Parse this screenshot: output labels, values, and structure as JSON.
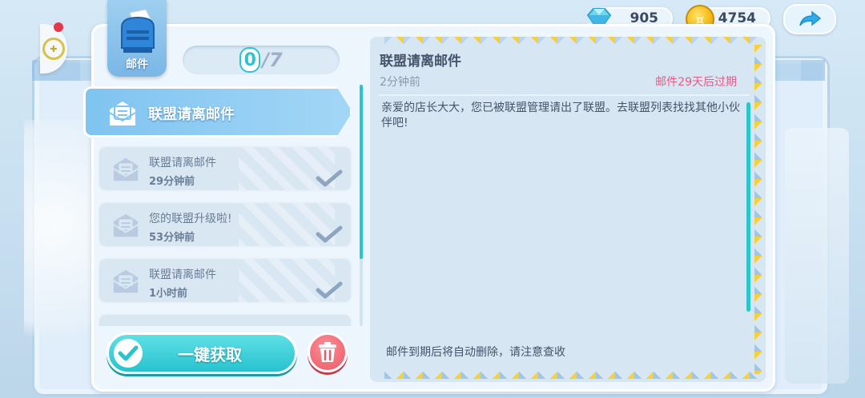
{
  "header": {
    "gems": "905",
    "coins": "4754"
  },
  "mailbox": {
    "label": "邮件"
  },
  "counter": {
    "read": "0",
    "total": "/7"
  },
  "mail_list": [
    {
      "title": "联盟请离邮件",
      "time": "",
      "selected": true,
      "read": false
    },
    {
      "title": "联盟请离邮件",
      "time": "29分钟前",
      "selected": false,
      "read": true
    },
    {
      "title": "您的联盟升级啦!",
      "time": "53分钟前",
      "selected": false,
      "read": true
    },
    {
      "title": "联盟请离邮件",
      "time": "1小时前",
      "selected": false,
      "read": true
    }
  ],
  "detail": {
    "title": "联盟请离邮件",
    "time": "2分钟前",
    "expire": "邮件29天后过期",
    "body": "亲爱的店长大大，您已被联盟管理请出了联盟。去联盟列表找找其他小伙伴吧!",
    "footer": "邮件到期后将自动删除，请注意查收"
  },
  "buttons": {
    "collect_all": "一键获取"
  },
  "colors": {
    "accent_teal": "#27c3cf",
    "delete_red": "#ea5966",
    "expire_pink": "#ea5a84",
    "panel_bg": "#eef6fd"
  },
  "icons": {
    "gem": "diamond-icon",
    "coin": "coin-icon",
    "share": "share-arrow-icon",
    "mailbox": "mailbox-icon",
    "mail": "envelope-icon",
    "check": "checkmark-icon",
    "delete": "trash-icon",
    "game": "gamepad-icon"
  }
}
